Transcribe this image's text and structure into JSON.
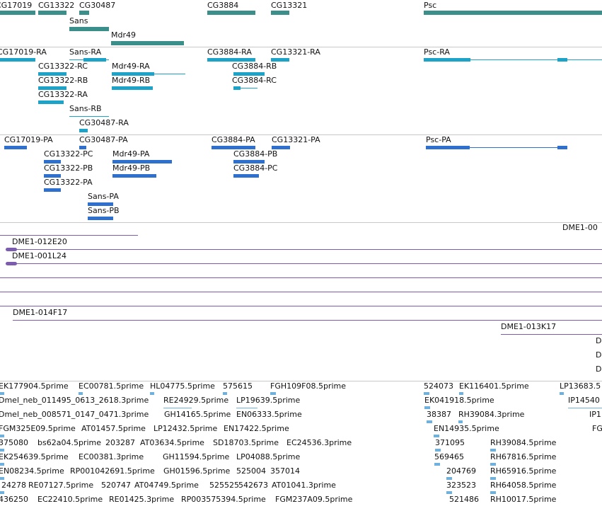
{
  "colors": {
    "gene": "#3a8f8a",
    "transcript": "#1ea3c8",
    "protein": "#2f6fce",
    "clone": "#7b5cae",
    "est": "#6fb0dd",
    "separator": "#c8c8c8"
  },
  "tiers": {
    "genes": {
      "labels": [
        "CG17019",
        "CG13322",
        "CG30487",
        "Sans",
        "Mdr49",
        "CG3884",
        "CG13321",
        "Psc"
      ]
    },
    "transcripts": {
      "labels": [
        "CG17019-RA",
        "Sans-RA",
        "CG13322-RC",
        "Mdr49-RA",
        "CG13322-RB",
        "Mdr49-RB",
        "CG13322-RA",
        "Sans-RB",
        "CG30487-RA",
        "CG3884-RA",
        "CG13321-RA",
        "CG3884-RB",
        "CG3884-RC",
        "Psc-RA"
      ]
    },
    "proteins": {
      "labels": [
        "CG17019-PA",
        "CG30487-PA",
        "CG13322-PC",
        "Mdr49-PA",
        "CG13322-PB",
        "Mdr49-PB",
        "CG13322-PA",
        "Sans-PA",
        "Sans-PB",
        "CG3884-PA",
        "CG13321-PA",
        "CG3884-PB",
        "CG3884-PC",
        "Psc-PA"
      ]
    },
    "clones": {
      "labels": [
        "DME1-012E20",
        "DME1-001L24",
        "DME1-014F17",
        "DME1-013K17",
        "DME1-00",
        "D",
        "D",
        "D"
      ]
    },
    "ests": {
      "rows": [
        [
          "EK177904.5prime",
          "EC00781.5prime",
          "HL04775.5prime",
          "575615",
          "FGH109F08.5prime",
          "524073",
          "EK116401.5prime",
          "LP13683.5"
        ],
        [
          "Dmel_neb_011495_0613_2618.3prime",
          "RE24929.5prime",
          "LP19639.5prime",
          "EK041918.5prime",
          "IP14540"
        ],
        [
          "Dmel_neb_008571_0147_0471.3prime",
          "GH14165.5prime",
          "EN06333.5prime",
          "38387",
          "RH39084.3prime",
          "IP1"
        ],
        [
          "FGM325E09.5prime",
          "AT01457.5prime",
          "LP12432.5prime",
          "EN17422.5prime",
          "EN14935.5prime",
          "FG"
        ],
        [
          "375080",
          "bs62a04.5prime",
          "203287",
          "AT03634.5prime",
          "SD18703.5prime",
          "EC24536.3prime",
          "371095",
          "RH39084.5prime"
        ],
        [
          "EK254639.5prime",
          "EC00381.3prime",
          "GH11594.5prime",
          "LP04088.5prime",
          "569465",
          "RH67816.5prime"
        ],
        [
          "EN08234.5prime",
          "RP001042691.5prime",
          "GH01596.5prime",
          "525004",
          "357014",
          "204769",
          "RH65916.5prime"
        ],
        [
          "24278",
          "RE07127.5prime",
          "520747",
          "AT04749.5prime",
          "525525",
          "542673",
          "AT01041.3prime",
          "323523",
          "RH64058.5prime"
        ],
        [
          "436250",
          "EC22410.5prime",
          "RE01425.3prime",
          "RP003575394.5prime",
          "FGM237A09.5prime",
          "521486",
          "RH10017.5prime"
        ]
      ]
    }
  }
}
